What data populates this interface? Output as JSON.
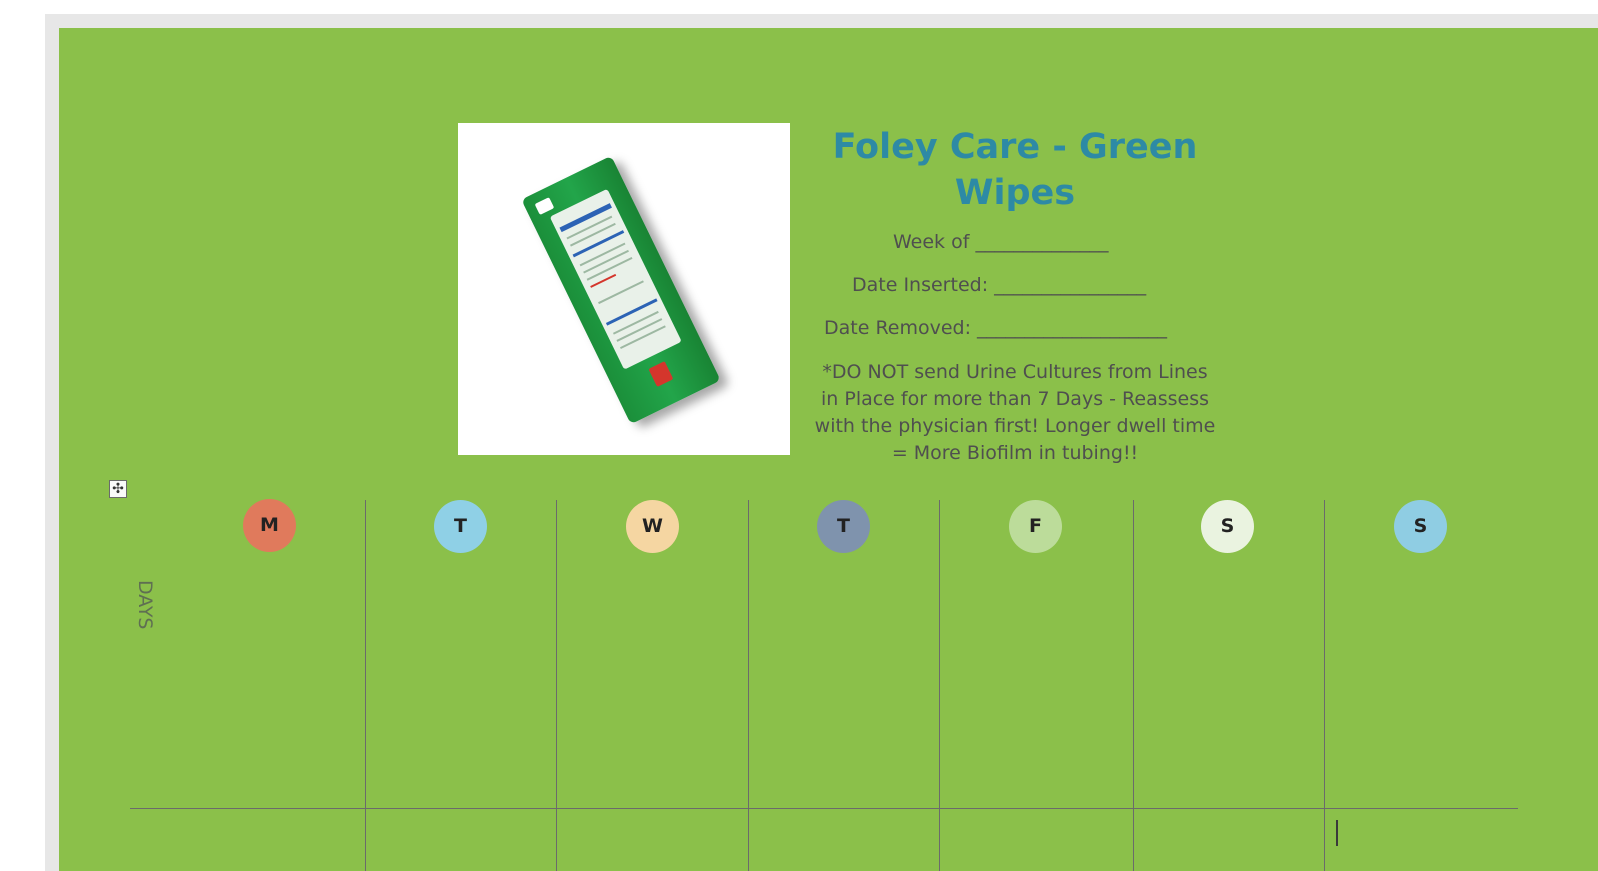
{
  "document": {
    "title": "Foley Care - Green Wipes",
    "fields": {
      "week_of": "Week of ______________",
      "date_inserted": "Date Inserted: ________________",
      "date_removed": "Date Removed: ____________________"
    },
    "note": "*DO NOT send Urine Cultures from Lines in Place for more than 7 Days - Reassess with the physician first!  Longer dwell time = More Biofilm in tubing!!",
    "product_image": "green-wipes-package",
    "table": {
      "move_handle": "✣",
      "row_label": "DAYS",
      "days": [
        {
          "label": "M",
          "color": "#e07a5c"
        },
        {
          "label": "T",
          "color": "#8fd0e6"
        },
        {
          "label": "W",
          "color": "#f5d6a2"
        },
        {
          "label": "T",
          "color": "#7f93ad"
        },
        {
          "label": "F",
          "color": "#bcdc9a"
        },
        {
          "label": "S",
          "color": "#eaf3e0"
        },
        {
          "label": "S",
          "color": "#8fcde3"
        }
      ]
    }
  },
  "colors": {
    "page_background": "#8bc04a",
    "title": "#2d8aa5",
    "text": "#4f4f4f"
  }
}
